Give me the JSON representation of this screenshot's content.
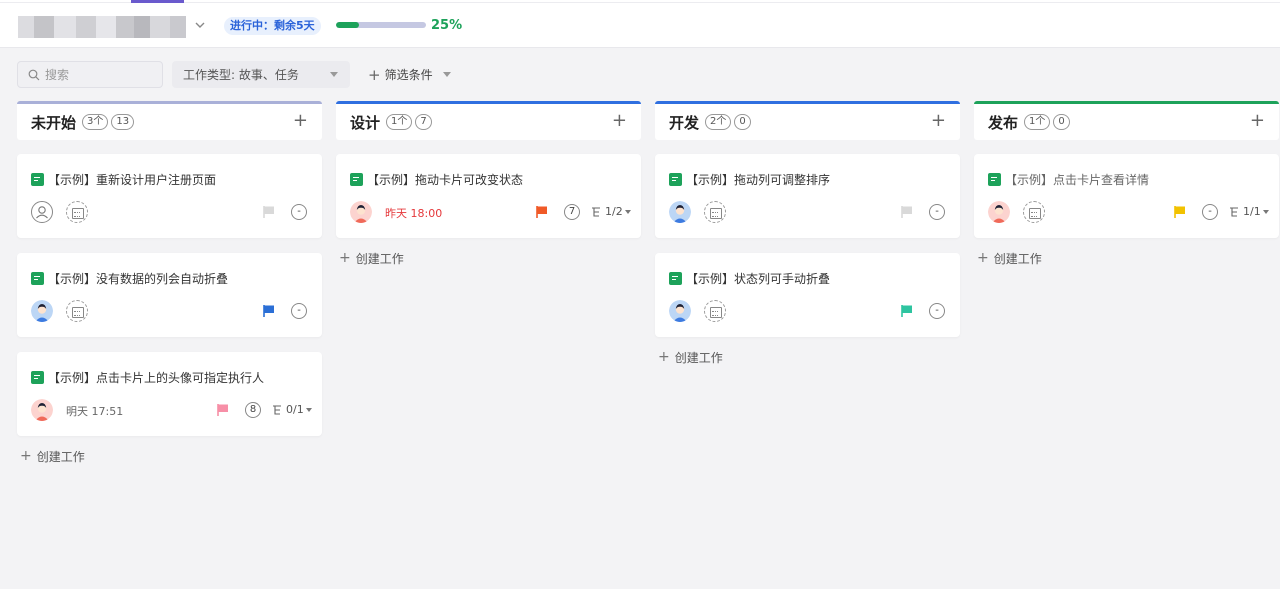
{
  "header": {
    "status_badge": "进行中：剩余5天",
    "progress_value": 25,
    "progress_text": "25%"
  },
  "filters": {
    "search_placeholder": "搜索",
    "type_filter_label": "工作类型: 故事、任务",
    "add_filter_label": "筛选条件"
  },
  "colors": {
    "accent": "#6a5acd",
    "progress": "#1da25a",
    "status_badge_text": "#2b63d9",
    "overdue": "#e5383b"
  },
  "columns": [
    {
      "title": "未开始",
      "count": "3个",
      "wip": "13",
      "border_color": "#a9b0d8",
      "create_label": "创建工作",
      "cards": [
        {
          "title": "【示例】重新设计用户注册页面",
          "assignee": "none",
          "due": "",
          "flag_color": "#d9d9d9",
          "priority": "-",
          "subtasks": ""
        },
        {
          "title": "【示例】没有数据的列会自动折叠",
          "assignee": "avatar-blue",
          "due": "",
          "flag_color": "#2b6fd6",
          "priority": "-",
          "subtasks": ""
        },
        {
          "title": "【示例】点击卡片上的头像可指定执行人",
          "assignee": "avatar-red",
          "due": "明天 17:51",
          "due_state": "normal",
          "flag_color": "#f78fa7",
          "priority": "8",
          "subtasks": "0/1"
        }
      ]
    },
    {
      "title": "设计",
      "count": "1个",
      "wip": "7",
      "border_color": "#2f6fe0",
      "create_label": "创建工作",
      "cards": [
        {
          "title": "【示例】拖动卡片可改变状态",
          "assignee": "avatar-red",
          "due": "昨天 18:00",
          "due_state": "overdue",
          "flag_color": "#f05a28",
          "priority": "7",
          "subtasks": "1/2"
        }
      ]
    },
    {
      "title": "开发",
      "count": "2个",
      "wip": "0",
      "border_color": "#2f6fe0",
      "create_label": "创建工作",
      "cards": [
        {
          "title": "【示例】拖动列可调整排序",
          "assignee": "avatar-blue",
          "due": "",
          "flag_color": "#d9d9d9",
          "priority": "-",
          "subtasks": ""
        },
        {
          "title": "【示例】状态列可手动折叠",
          "assignee": "avatar-blue",
          "due": "",
          "flag_color": "#2ec4a0",
          "priority": "-",
          "subtasks": ""
        }
      ]
    },
    {
      "title": "发布",
      "count": "1个",
      "wip": "0",
      "border_color": "#1da25a",
      "create_label": "创建工作",
      "cards": [
        {
          "title": "【示例】点击卡片查看详情",
          "assignee": "avatar-red",
          "due": "",
          "flag_color": "#f2c200",
          "priority": "-",
          "subtasks": "1/1",
          "dim": true
        }
      ]
    }
  ]
}
